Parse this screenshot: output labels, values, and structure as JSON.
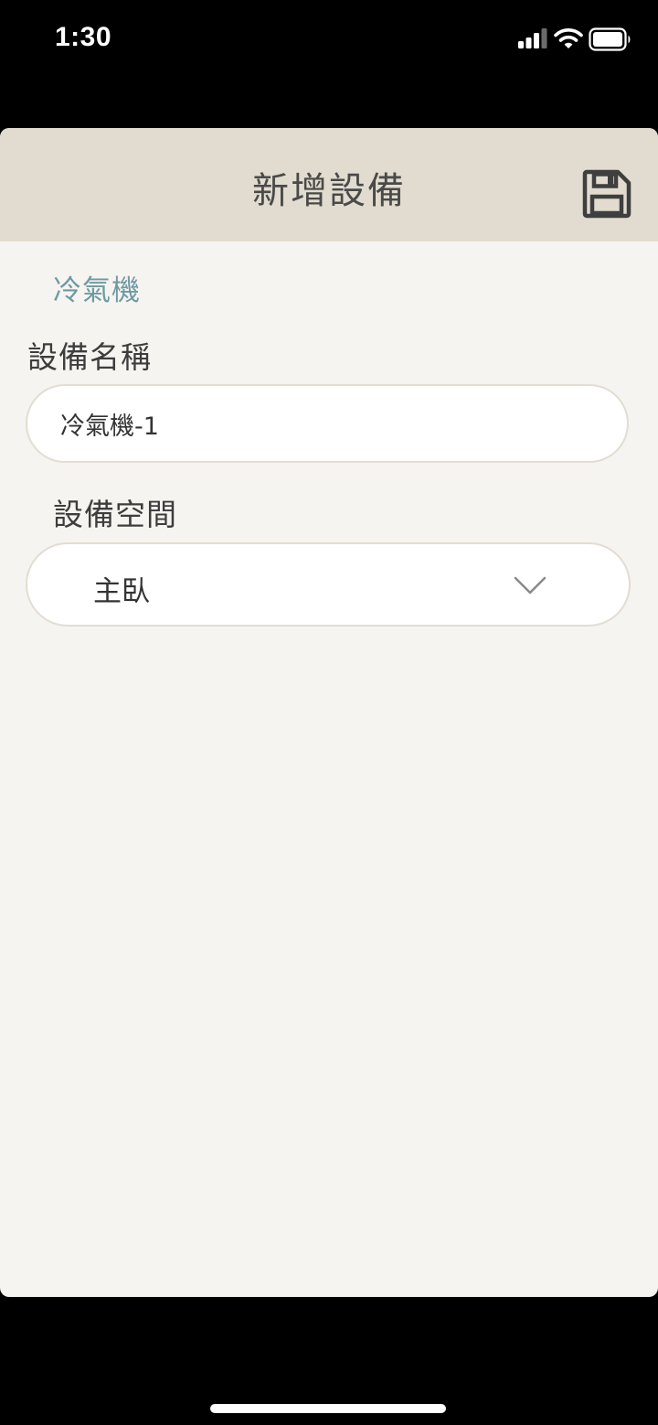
{
  "status_bar": {
    "time": "1:30",
    "icons": [
      "signal-icon",
      "wifi-icon",
      "battery-icon"
    ]
  },
  "header": {
    "title": "新增設備",
    "save_icon": "save-icon"
  },
  "device_type": "冷氣機",
  "form": {
    "name_label": "設備名稱",
    "name_value": "冷氣機-1",
    "space_label": "設備空間",
    "space_value": "主臥",
    "space_icon": "chevron-down-icon"
  },
  "colors": {
    "header_bg": "#e1dccf",
    "sheet_bg": "#f6f4f0",
    "accent_text": "#6d9aa3",
    "border": "#e2ddd2"
  }
}
